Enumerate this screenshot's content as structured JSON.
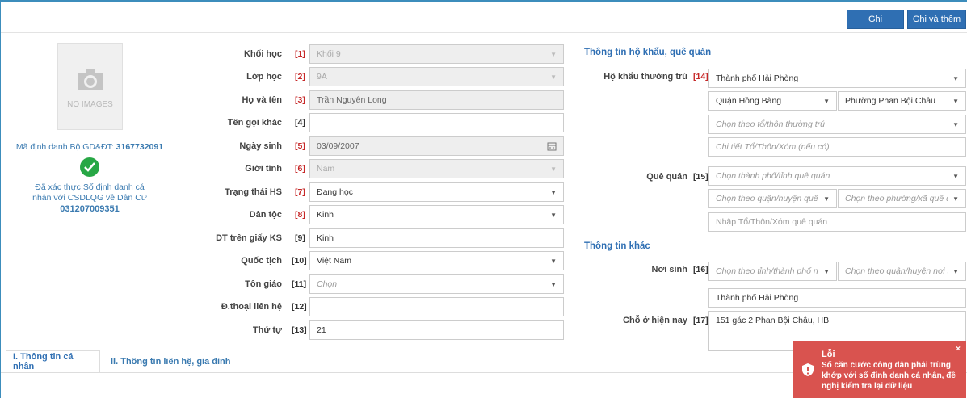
{
  "toolbar": {
    "save_label": "Ghi",
    "save_add_label": "Ghi và thêm"
  },
  "photo": {
    "no_images": "NO IMAGES"
  },
  "identity": {
    "id_label": "Mã định danh Bộ GD&ĐT:",
    "id_value": "3167732091",
    "verified_line1": "Đã xác thực Số định danh cá",
    "verified_line2": "nhân với CSDLQG về Dân Cư",
    "citizen_id": "031207009351"
  },
  "fields": {
    "khoi_hoc": {
      "label": "Khối học",
      "num": "[1]",
      "value": "Khối 9"
    },
    "lop_hoc": {
      "label": "Lớp học",
      "num": "[2]",
      "value": "9A"
    },
    "ho_ten": {
      "label": "Họ và tên",
      "num": "[3]",
      "value": "Trần Nguyên Long"
    },
    "ten_goi_khac": {
      "label": "Tên gọi khác",
      "num": "[4]",
      "value": ""
    },
    "ngay_sinh": {
      "label": "Ngày sinh",
      "num": "[5]",
      "value": "03/09/2007"
    },
    "gioi_tinh": {
      "label": "Giới tính",
      "num": "[6]",
      "value": "Nam"
    },
    "trang_thai": {
      "label": "Trạng thái HS",
      "num": "[7]",
      "value": "Đang học"
    },
    "dan_toc": {
      "label": "Dân tộc",
      "num": "[8]",
      "value": "Kinh"
    },
    "dt_giay_ks": {
      "label": "DT trên giấy KS",
      "num": "[9]",
      "value": "Kinh"
    },
    "quoc_tich": {
      "label": "Quốc tịch",
      "num": "[10]",
      "value": "Việt Nam"
    },
    "ton_giao": {
      "label": "Tôn giáo",
      "num": "[11]",
      "placeholder": "Chọn"
    },
    "dien_thoai": {
      "label": "Đ.thoại liên hệ",
      "num": "[12]",
      "value": ""
    },
    "thu_tu": {
      "label": "Thứ tự",
      "num": "[13]",
      "value": "21"
    }
  },
  "household": {
    "section_title": "Thông tin hộ khẩu, quê quán",
    "ho_khau_label": "Hộ khẩu thường trú",
    "ho_khau_num": "[14]",
    "city": "Thành phố Hải Phòng",
    "district": "Quận Hồng Bàng",
    "ward": "Phường Phan Bội Châu",
    "hamlet_placeholder": "Chọn theo tổ/thôn thường trú",
    "detail_placeholder": "Chi tiết Tổ/Thôn/Xóm (nếu có)",
    "que_quan_label": "Quê quán",
    "que_quan_num": "[15]",
    "qq_city_placeholder": "Chọn thành phố/tỉnh quê quán",
    "qq_district_placeholder": "Chọn theo quận/huyện quê quán",
    "qq_ward_placeholder": "Chọn theo phường/xã quê quán",
    "qq_hamlet_placeholder": "Nhập Tổ/Thôn/Xóm quê quán"
  },
  "other": {
    "section_title": "Thông tin khác",
    "noi_sinh_label": "Nơi sinh",
    "noi_sinh_num": "[16]",
    "ns_city_placeholder": "Chọn theo tỉnh/thành phố nơi sinh",
    "ns_district_placeholder": "Chọn theo quận/huyện nơi sinh",
    "ns_text": "Thành phố Hải Phòng",
    "cho_o_label": "Chỗ ở hiện nay",
    "cho_o_num": "[17]",
    "cho_o_value": "151 gác 2 Phan Bội Châu, HB"
  },
  "tabs": [
    {
      "label": "I. Thông tin cá nhân"
    },
    {
      "label": "II. Thông tin liên hệ, gia đình"
    }
  ],
  "toast": {
    "title": "Lỗi",
    "message": "Số căn cước công dân phải trùng khớp với số định danh cá nhân, đề nghị kiểm tra lại dữ liệu",
    "close": "×"
  },
  "colors": {
    "primary": "#2f6fb3",
    "error": "#d9534f",
    "success": "#27a745",
    "required": "#c62828"
  }
}
